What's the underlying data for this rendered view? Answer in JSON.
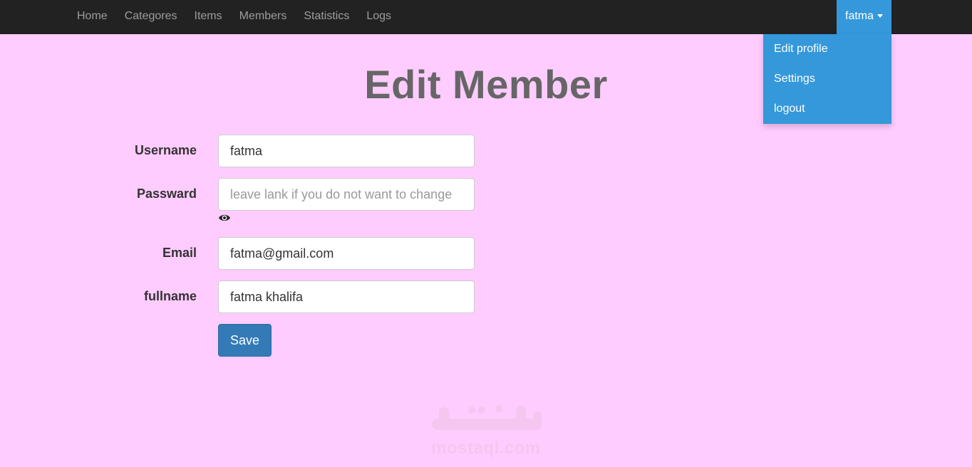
{
  "nav": {
    "links": [
      "Home",
      "Categores",
      "Items",
      "Members",
      "Statistics",
      "Logs"
    ],
    "user": "fatma",
    "dropdown": [
      "Edit profile",
      "Settings",
      "logout"
    ]
  },
  "page": {
    "title": "Edit Member"
  },
  "form": {
    "username": {
      "label": "Username",
      "value": "fatma"
    },
    "password": {
      "label": "Passward",
      "placeholder": "leave lank if you do not want to change",
      "toggle_icon": "eye-icon"
    },
    "email": {
      "label": "Email",
      "value": "fatma@gmail.com"
    },
    "fullname": {
      "label": "fullname",
      "value": "fatma khalifa"
    },
    "save_label": "Save"
  },
  "watermark": {
    "text": "mostaql.com"
  },
  "colors": {
    "page_background": "#ffccff",
    "navbar": "#222222",
    "accent": "#3498db",
    "save_button": "#337ab7"
  }
}
